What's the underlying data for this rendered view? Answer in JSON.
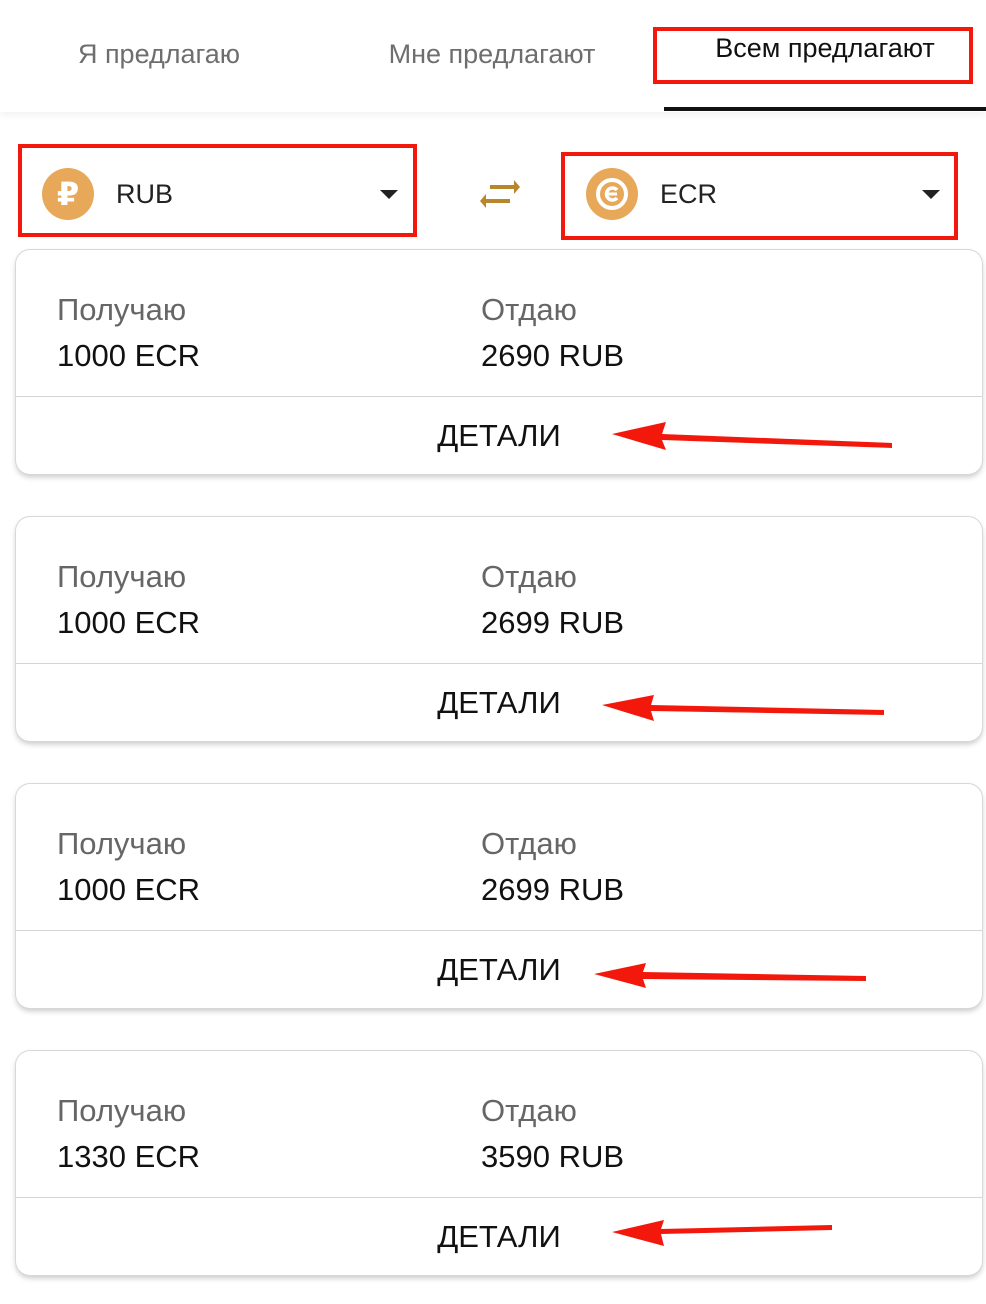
{
  "tabs": [
    {
      "label": "Я предлагаю"
    },
    {
      "label": "Мне предлагают"
    },
    {
      "label": "Всем предлагают"
    }
  ],
  "from_currency": {
    "code": "RUB",
    "symbol": "₽"
  },
  "to_currency": {
    "code": "ECR"
  },
  "offers": [
    {
      "receive_label": "Получаю",
      "receive_value": "1000 ECR",
      "give_label": "Отдаю",
      "give_value": "2690 RUB",
      "details_label": "ДЕТАЛИ"
    },
    {
      "receive_label": "Получаю",
      "receive_value": "1000 ECR",
      "give_label": "Отдаю",
      "give_value": "2699 RUB",
      "details_label": "ДЕТАЛИ"
    },
    {
      "receive_label": "Получаю",
      "receive_value": "1000 ECR",
      "give_label": "Отдаю",
      "give_value": "2699 RUB",
      "details_label": "ДЕТАЛИ"
    },
    {
      "receive_label": "Получаю",
      "receive_value": "1330 ECR",
      "give_label": "Отдаю",
      "give_value": "3590 RUB",
      "details_label": "ДЕТАЛИ"
    }
  ],
  "colors": {
    "accent": "#e7a959",
    "swap_icon": "#b8862b",
    "annotation": "#f2190c"
  }
}
